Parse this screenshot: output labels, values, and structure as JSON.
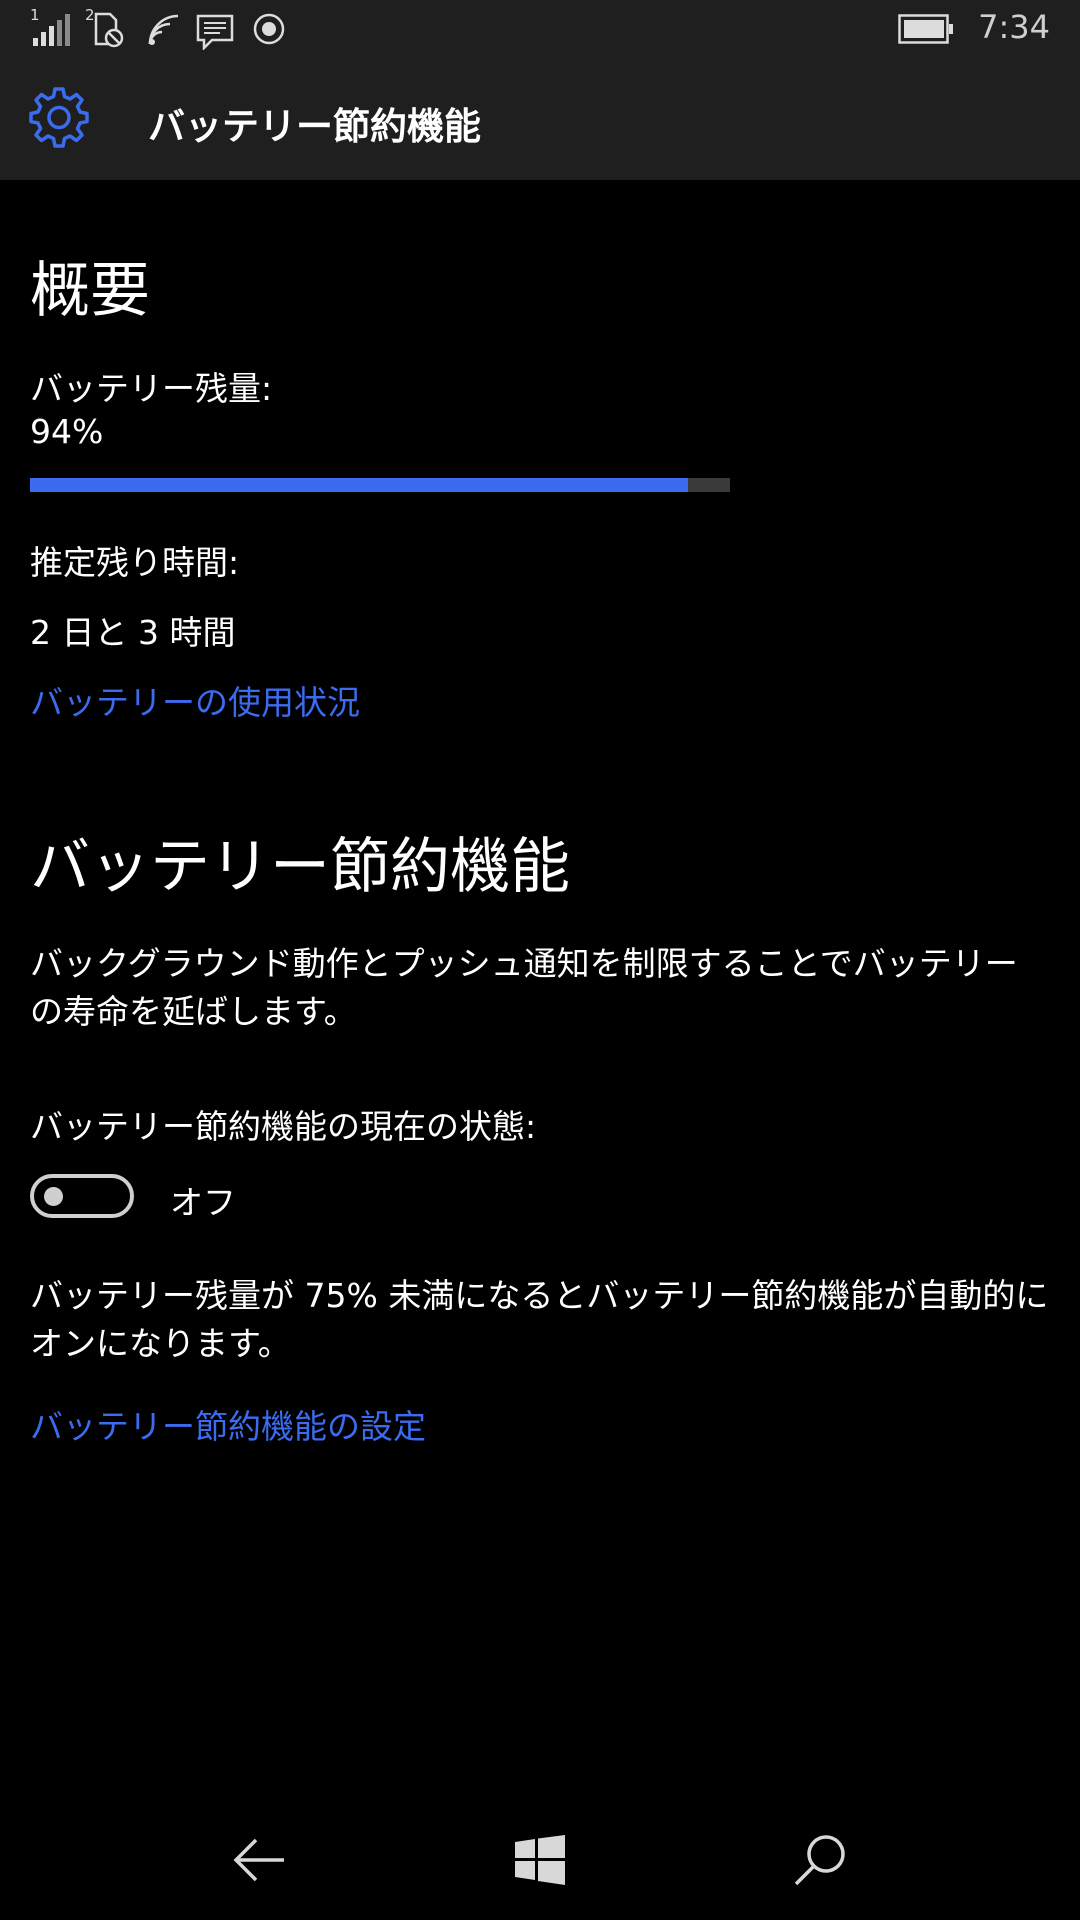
{
  "status_bar": {
    "sim1_label": "1",
    "sim2_label": "2",
    "time": "7:34",
    "icons": [
      "signal-bars-icon",
      "no-sim-icon",
      "wifi-icon",
      "message-icon",
      "location-icon",
      "battery-icon"
    ]
  },
  "header": {
    "title": "バッテリー節約機能",
    "icon": "gear-icon"
  },
  "overview": {
    "heading": "概要",
    "battery_label": "バッテリー残量:",
    "battery_value": "94%",
    "battery_level": 0.94,
    "estimate_label": "推定残り時間:",
    "estimate_value": "2 日と 3 時間",
    "usage_link": "バッテリーの使用状況"
  },
  "saver": {
    "heading": "バッテリー節約機能",
    "description": "バックグラウンド動作とプッシュ通知を制限することでバッテリーの寿命を延ばします。",
    "status_label": "バッテリー節約機能の現在の状態:",
    "toggle_state": "オフ",
    "auto_text": "バッテリー残量が 75% 未満になるとバッテリー節約機能が自動的にオンになります。",
    "settings_link": "バッテリー節約機能の設定"
  },
  "nav": {
    "icons": [
      "back-arrow-icon",
      "windows-logo-icon",
      "search-icon"
    ]
  },
  "colors": {
    "accent": "#3b6cf0",
    "background": "#000000",
    "bar_background": "#1f1f1f"
  }
}
